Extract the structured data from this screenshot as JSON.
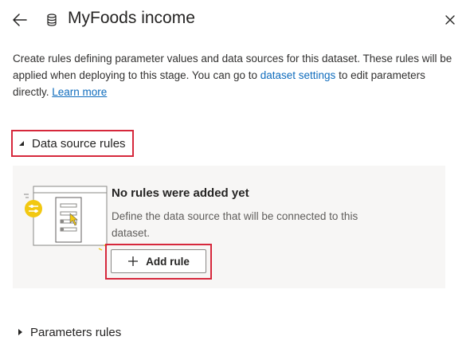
{
  "header": {
    "title": "MyFoods income",
    "back_icon": "arrow-left-icon",
    "dataset_icon": "database-icon",
    "close_icon": "close-icon"
  },
  "description": {
    "text_part1": "Create rules defining parameter values and data sources for this dataset. These rules will be applied when deploying to this stage. You can go to ",
    "settings_link": "dataset settings",
    "text_part2": " to edit parameters directly. ",
    "learn_more_link": "Learn more"
  },
  "data_source_rules": {
    "label": "Data source rules",
    "expanded": true,
    "empty_state": {
      "title": "No rules were added yet",
      "description": "Define the data source that will be connected to this dataset.",
      "add_button_label": "Add rule",
      "illustration_icon": "rules-illustration-icon"
    }
  },
  "parameters_rules": {
    "label": "Parameters rules",
    "expanded": false
  },
  "colors": {
    "link": "#0f6cbd",
    "highlight": "#d6283c",
    "card_bg": "#f7f6f5",
    "illustration_accent": "#f2c811"
  }
}
